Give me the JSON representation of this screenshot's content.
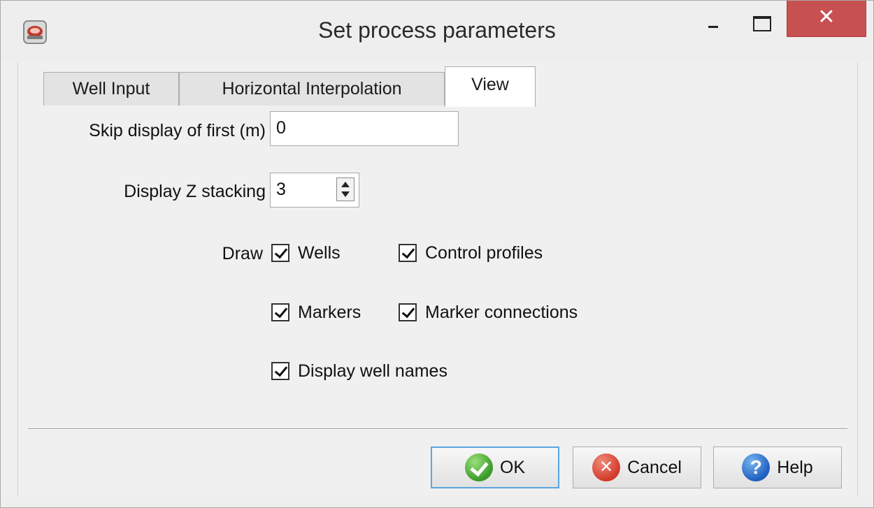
{
  "window": {
    "title": "Set process parameters",
    "minimize_label": "",
    "close_label": "✕"
  },
  "tabs": [
    {
      "label": "Well Input",
      "selected": false
    },
    {
      "label": "Horizontal Interpolation",
      "selected": false
    },
    {
      "label": "View",
      "selected": true
    }
  ],
  "view_tab": {
    "skip_display": {
      "label": "Skip display of first (m)",
      "value": "0"
    },
    "z_stacking": {
      "label": "Display Z stacking",
      "value": "3"
    },
    "draw_label": "Draw",
    "checkboxes": [
      {
        "label": "Wells",
        "checked": true
      },
      {
        "label": "Control profiles",
        "checked": true
      },
      {
        "label": "Markers",
        "checked": true
      },
      {
        "label": "Marker connections",
        "checked": true
      },
      {
        "label": "Display well names",
        "checked": true
      }
    ]
  },
  "buttons": {
    "ok": "OK",
    "cancel": "Cancel",
    "help": "Help"
  },
  "icons": {
    "app": "app-logo-icon",
    "ok": "check-circle-icon",
    "cancel": "x-circle-icon",
    "help": "question-circle-icon"
  },
  "colors": {
    "close_button": "#c75050",
    "ok_focus_border": "#5aa6e0"
  }
}
